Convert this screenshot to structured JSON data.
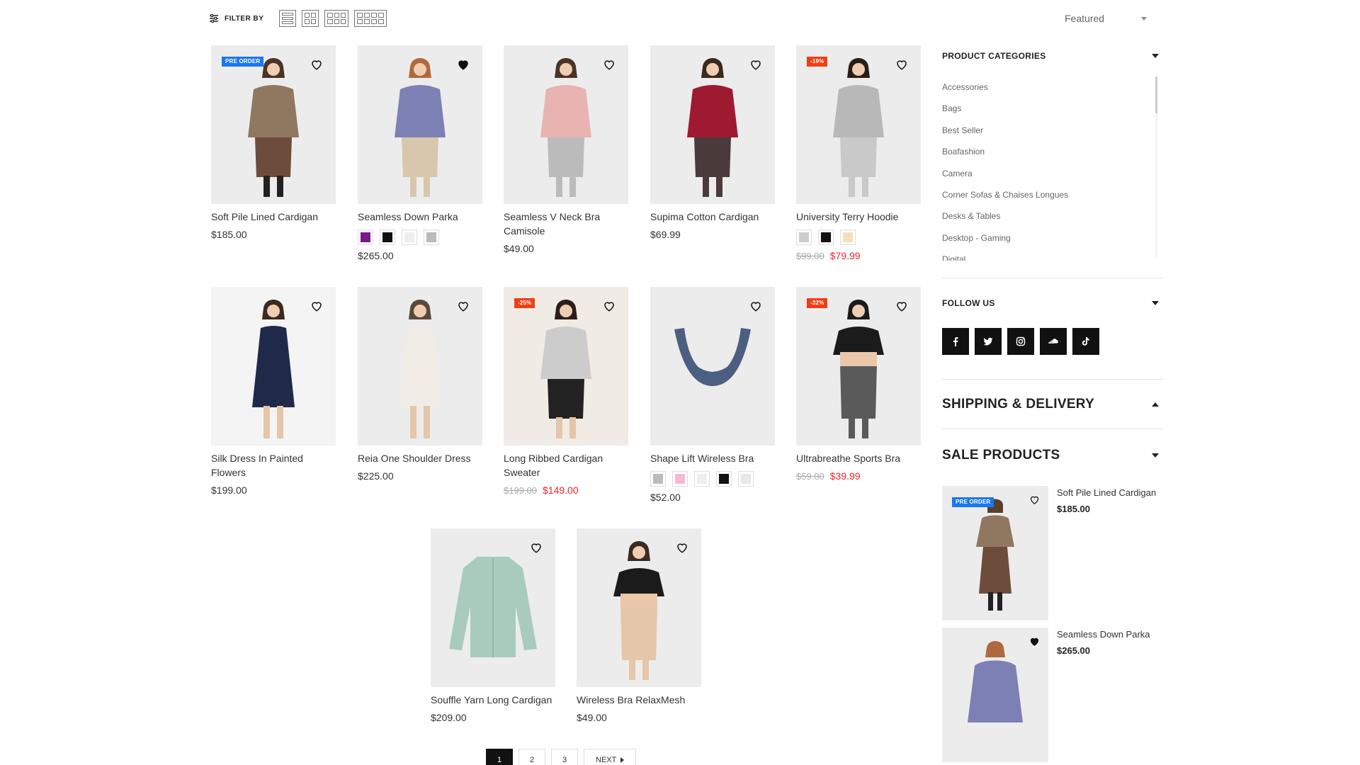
{
  "toolbar": {
    "filter_label": "FILTER BY",
    "view_modes": [
      "list-view",
      "grid-2",
      "grid-3",
      "grid-4"
    ],
    "sort_value": "Featured"
  },
  "products": [
    {
      "name": "Soft Pile Lined Cardigan",
      "price": "$185.00",
      "badge": "PRE ORDER",
      "badge_type": "pre",
      "wishlisted": false
    },
    {
      "name": "Seamless Down Parka",
      "price": "$265.00",
      "badge": "",
      "wishlisted": true,
      "swatches": [
        "#7a1a8a",
        "#111111",
        "#eeeeee",
        "#bbbbbb"
      ]
    },
    {
      "name": "Seamless V Neck Bra Camisole",
      "price": "$49.00",
      "badge": "",
      "wishlisted": false
    },
    {
      "name": "Supima Cotton Cardigan",
      "price": "$69.99",
      "badge": "",
      "wishlisted": false
    },
    {
      "name": "University Terry Hoodie",
      "old_price": "$99.00",
      "price": "$79.99",
      "badge": "-19%",
      "badge_type": "sale",
      "wishlisted": false,
      "swatches": [
        "#cccccc",
        "#111111",
        "#f3dfb9"
      ]
    },
    {
      "name": "Silk Dress In Painted Flowers",
      "price": "$199.00",
      "badge": "",
      "wishlisted": false
    },
    {
      "name": "Reia One Shoulder Dress",
      "price": "$225.00",
      "badge": "",
      "wishlisted": false
    },
    {
      "name": "Long Ribbed Cardigan Sweater",
      "old_price": "$199.00",
      "price": "$149.00",
      "badge": "-25%",
      "badge_type": "sale",
      "wishlisted": false
    },
    {
      "name": "Shape Lift Wireless Bra",
      "price": "$52.00",
      "badge": "",
      "wishlisted": false,
      "swatches": [
        "#bbbbbb",
        "#f7b8d6",
        "#eeeeee",
        "#111111",
        "#e8e8e8"
      ]
    },
    {
      "name": "Ultrabreathe Sports Bra",
      "old_price": "$59.00",
      "price": "$39.99",
      "badge": "-32%",
      "badge_type": "sale",
      "wishlisted": false
    },
    {
      "name": "Souffle Yarn Long Cardigan",
      "price": "$209.00",
      "badge": "",
      "wishlisted": false
    },
    {
      "name": "Wireless Bra RelaxMesh",
      "price": "$49.00",
      "badge": "",
      "wishlisted": false
    }
  ],
  "sidebar": {
    "categories_title": "PRODUCT CATEGORIES",
    "categories": [
      "Accessories",
      "Bags",
      "Best Seller",
      "Boafashion",
      "Camera",
      "Corner Sofas & Chaises Longues",
      "Desks & Tables",
      "Desktop - Gaming",
      "Digital"
    ],
    "follow_title": "FOLLOW US",
    "socials": [
      "facebook-icon",
      "twitter-icon",
      "instagram-icon",
      "soundcloud-icon",
      "tiktok-icon"
    ],
    "shipping_title": "SHIPPING & DELIVERY",
    "sale_title": "SALE PRODUCTS",
    "sale_products": [
      {
        "name": "Soft Pile Lined Cardigan",
        "price": "$185.00",
        "badge": "PRE ORDER"
      },
      {
        "name": "Seamless Down Parka",
        "price": "$265.00",
        "badge": ""
      }
    ]
  },
  "pagination": {
    "pages": [
      "1",
      "2",
      "3"
    ],
    "active": "1",
    "next_label": "NEXT"
  },
  "colors": {
    "pre_order_badge": "#1877f2",
    "sale_badge": "#ef3e16",
    "sale_price": "#e8272b"
  }
}
